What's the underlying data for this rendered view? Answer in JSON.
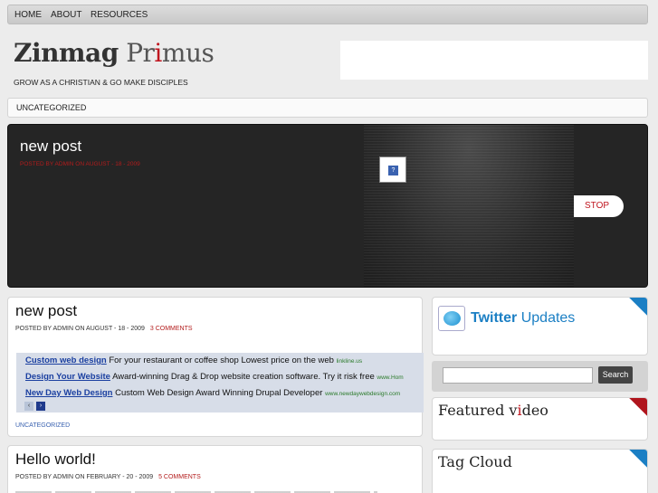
{
  "nav": {
    "items": [
      "HOME",
      "ABOUT",
      "RESOURCES"
    ]
  },
  "site": {
    "title_bold": "Zinmag",
    "title_rest_1": "Pr",
    "title_red": "i",
    "title_rest_2": "mus",
    "tagline": "GROW AS A CHRISTIAN & GO MAKE DISCIPLES"
  },
  "categories": {
    "item": "UNCATEGORIZED"
  },
  "slider": {
    "title": "new post",
    "meta": "POSTED BY ADMIN ON AUGUST - 18 - 2009",
    "thumb_icon": "?",
    "stop_label": "STOP"
  },
  "posts": [
    {
      "title": "new post",
      "meta": "POSTED BY ADMIN  ON AUGUST - 18 - 2009",
      "comments": "3 COMMENTS",
      "category": "UNCATEGORIZED"
    },
    {
      "title": "Hello world!",
      "meta": "POSTED BY ADMIN  ON FEBRUARY - 20 - 2009",
      "comments": "5 COMMENTS"
    }
  ],
  "ads": [
    {
      "link": "Custom web design",
      "text": " For your restaurant or coffee shop Lowest price on the web ",
      "url": "linkline.us"
    },
    {
      "link": "Design Your Website",
      "text": " Award-winning Drag & Drop website creation software. Try it risk free ",
      "url": "www.Hom"
    },
    {
      "link": "New Day Web Design",
      "text": " Custom Web Design Award Winning Drupal Developer ",
      "url": "www.newdaywebdesign.com"
    }
  ],
  "ad_nav": {
    "prev": "‹",
    "next": "›"
  },
  "widgets": {
    "twitter": {
      "bold": "Twitter",
      "rest": " Updates"
    },
    "search": {
      "placeholder": "",
      "button": "Search"
    },
    "video": {
      "part1": "Featured v",
      "red": "i",
      "part2": "deo"
    },
    "tags": {
      "title": "Tag Cloud"
    }
  },
  "colors": {
    "accent_red": "#c0161f",
    "accent_blue": "#1b7fc4"
  },
  "icons": {
    "twitter": "twitter-bird-icon",
    "slider_thumb": "broken-image-icon"
  }
}
